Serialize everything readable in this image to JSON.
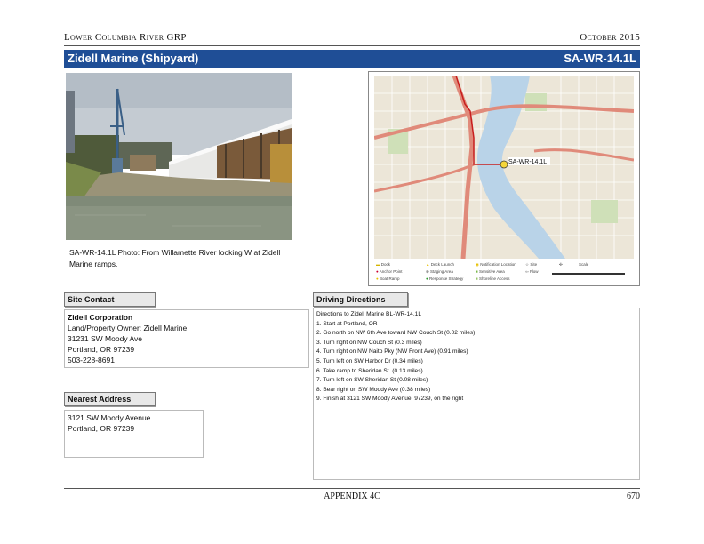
{
  "header": {
    "left": "Lower Columbia River GRP",
    "right": "October 2015"
  },
  "title": {
    "site_name": "Zidell Marine (Shipyard)",
    "site_code": "SA-WR-14.1L"
  },
  "photo": {
    "caption": "SA-WR-14.1L Photo: From Willamette River looking W at Zidell Marine ramps."
  },
  "map": {
    "site_label": "SA-WR-14.1L",
    "legend": [
      "Dock",
      "Anchor Point",
      "Boat Ramp",
      "Deck Launch",
      "Staging Area",
      "Response Strategy",
      "Notification Location",
      "Sensitive Area",
      "Shoreline Access",
      "Site",
      "Flow",
      "Scale",
      "North"
    ],
    "colors": {
      "water": "#b9d3e8",
      "land": "#ece6d8",
      "highway": "#e08a7a",
      "route": "#c81e1e",
      "park": "#cfe0b8"
    }
  },
  "site_contact": {
    "heading": "Site Contact",
    "company": "Zidell Corporation",
    "lines": [
      "Land/Property Owner: Zidell Marine",
      "31231 SW Moody Ave",
      "Portland, OR 97239",
      "503-228-8691"
    ]
  },
  "nearest_address": {
    "heading": "Nearest Address",
    "lines": [
      "3121 SW Moody Avenue",
      "Portland, OR 97239"
    ]
  },
  "driving_directions": {
    "heading": "Driving Directions",
    "lines": [
      "Directions to Zidell Marine BL-WR-14.1L",
      "1. Start at Portland, OR",
      "2. Go north on NW 6th Ave toward NW Couch St (0.02 miles)",
      "3. Turn right on NW Couch St (0.3 miles)",
      "4. Turn right on NW Naito Pky (NW Front Ave) (0.91 miles)",
      "5. Turn left on SW Harbor Dr (0.34 miles)",
      "6. Take ramp to Sheridan St. (0.13 miles)",
      "7. Turn left on SW Sheridan St (0.08 miles)",
      "8. Bear right on SW Moody Ave (0.38 miles)",
      "9. Finish at 3121 SW Moody Avenue, 97239, on the right"
    ]
  },
  "footer": {
    "center": "APPENDIX 4C",
    "page": "670"
  }
}
